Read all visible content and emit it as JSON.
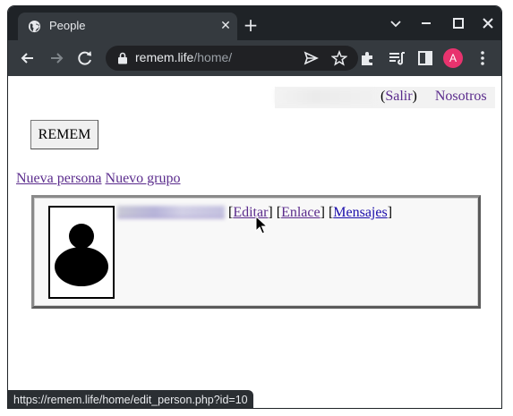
{
  "browser": {
    "tab": {
      "title": "People",
      "favicon": "globe-icon",
      "close": "✕"
    },
    "new_tab": "+",
    "window_controls": [
      "chevron-down-icon",
      "minimize-icon",
      "maximize-icon",
      "close-icon"
    ],
    "address": {
      "host": "remem.life",
      "path": "/home/"
    },
    "profile_initial": "A",
    "colors": {
      "frame": "#1f2327",
      "toolbar": "#353a3f",
      "avatar": "#e8336e"
    }
  },
  "page": {
    "topbar": {
      "logout_prefix": "(",
      "logout_label": "Salir",
      "logout_suffix": ")",
      "about_label": "Nosotros"
    },
    "brand_button": "REMEM",
    "actions": {
      "new_person": "Nueva persona",
      "new_group": "Nuevo grupo"
    },
    "person": {
      "edit_label": "Editar",
      "link_label": "Enlace",
      "messages_label": "Mensajes",
      "open_bracket": "[",
      "close_bracket": "]"
    }
  },
  "status_bar": {
    "url": "https://remem.life/home/edit_person.php?id=10"
  }
}
